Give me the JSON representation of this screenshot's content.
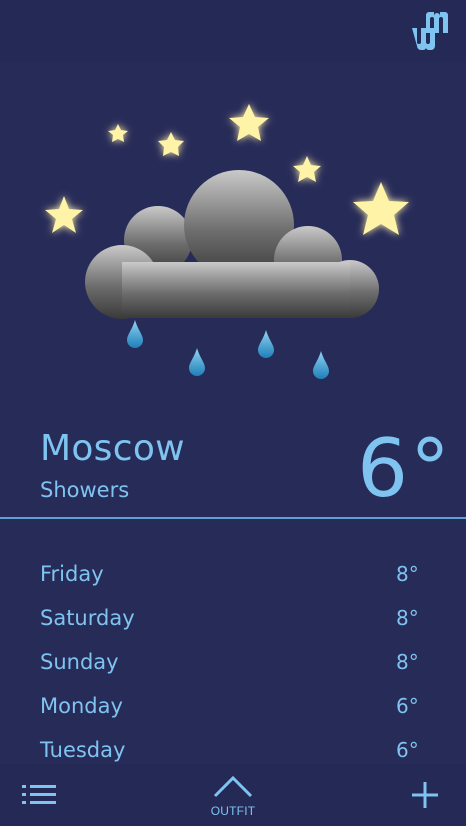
{
  "location": {
    "city": "Moscow",
    "condition": "Showers",
    "temperature": "6°"
  },
  "forecast": [
    {
      "day": "Friday",
      "temp": "8°"
    },
    {
      "day": "Saturday",
      "temp": "8°"
    },
    {
      "day": "Sunday",
      "temp": "8°"
    },
    {
      "day": "Monday",
      "temp": "6°"
    },
    {
      "day": "Tuesday",
      "temp": "6°"
    }
  ],
  "bottom_bar": {
    "outfit_label": "OUTFIT"
  },
  "icons": {
    "logo": "app-logo-icon",
    "weather": "night-cloud-rain-icon",
    "menu": "list-icon",
    "outfit": "chevron-up-icon",
    "add": "plus-icon"
  },
  "colors": {
    "background": "#272b58",
    "bars": "#252955",
    "text": "#7fc3f0",
    "divider": "#5f9fd6",
    "star": "#fff3a8",
    "rain": "#3aa3d8"
  }
}
